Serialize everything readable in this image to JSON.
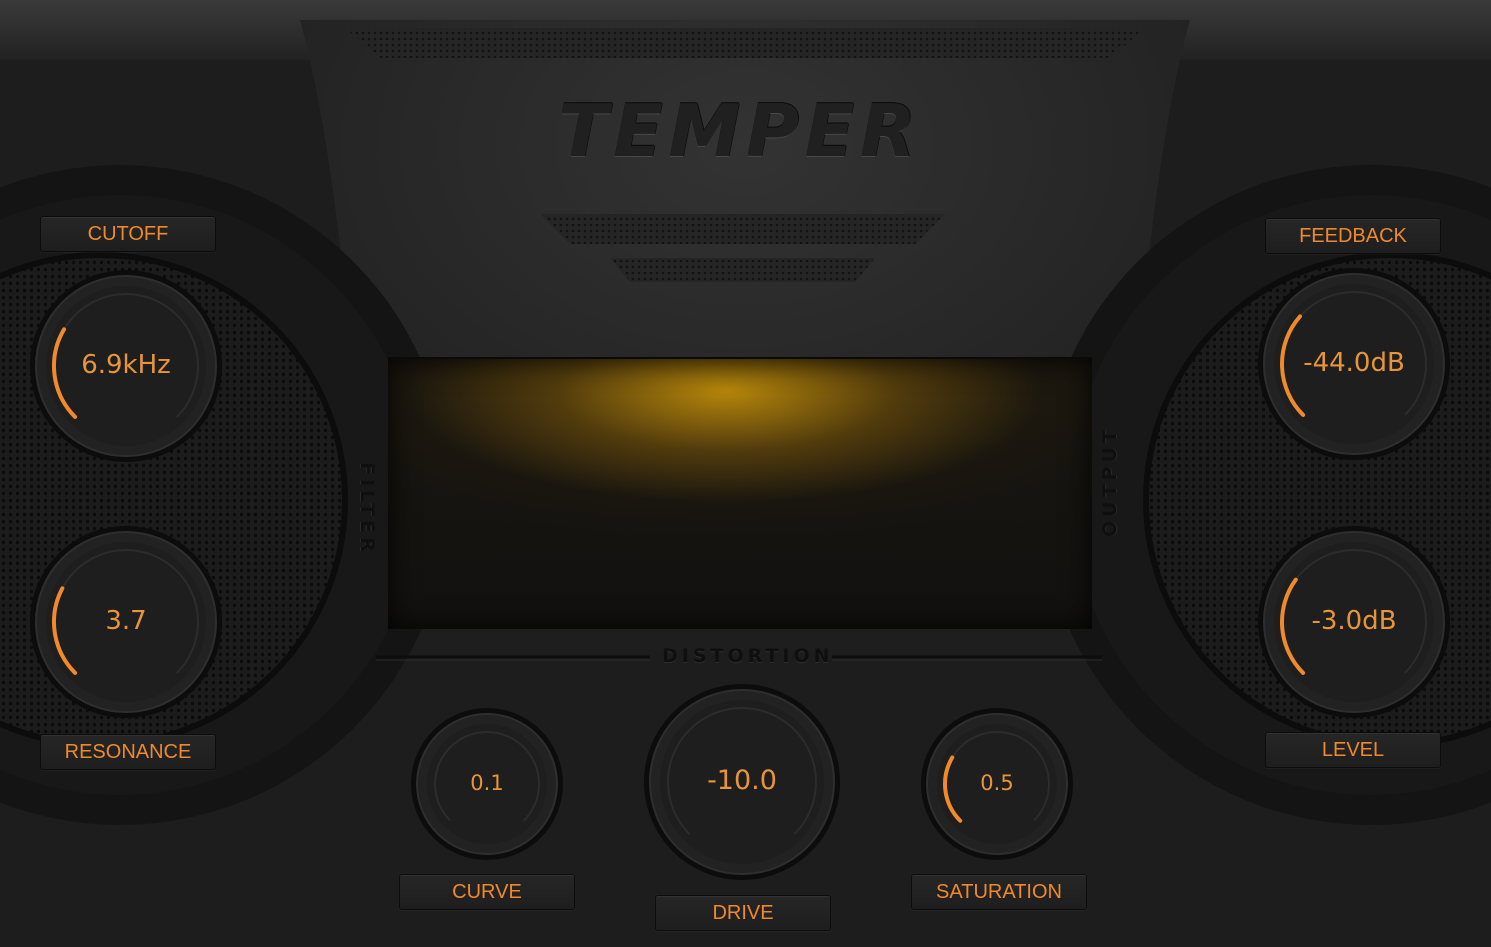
{
  "brand": {
    "logo_text": "TEMPER"
  },
  "display": {
    "glow_color": "#c08a0c"
  },
  "sections": {
    "filter": "FILTER",
    "output": "OUTPUT",
    "distortion": "DISTORTION"
  },
  "accent_color": "#f08a2a",
  "knobs": {
    "cutoff": {
      "label": "CUTOFF",
      "value": "6.9kHz",
      "fraction": 0.28
    },
    "resonance": {
      "label": "RESONANCE",
      "value": "3.7",
      "fraction": 0.27
    },
    "feedback": {
      "label": "FEEDBACK",
      "value": "-44.0dB",
      "fraction": 0.32
    },
    "level": {
      "label": "LEVEL",
      "value": "-3.0dB",
      "fraction": 0.3
    },
    "curve": {
      "label": "CURVE",
      "value": "0.1",
      "fraction": 0.0
    },
    "drive": {
      "label": "DRIVE",
      "value": "-10.0",
      "fraction": 0.0
    },
    "saturation": {
      "label": "SATURATION",
      "value": "0.5",
      "fraction": 0.28
    }
  }
}
